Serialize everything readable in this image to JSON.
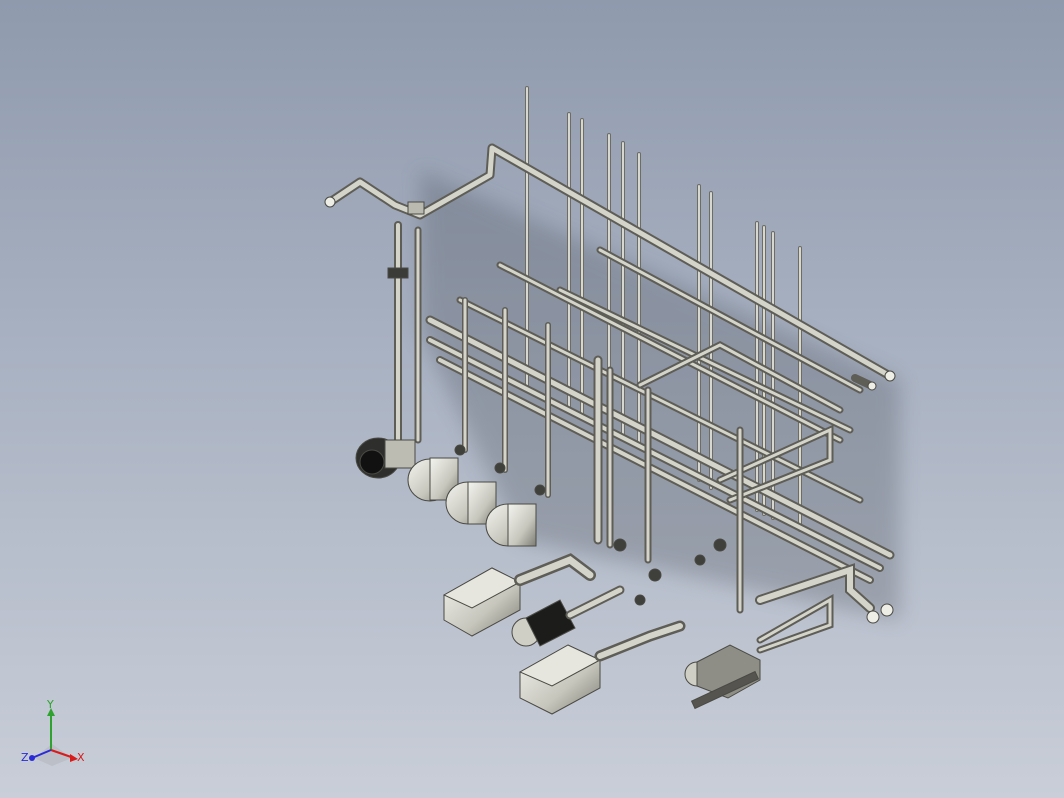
{
  "view": {
    "background_top": "#8f9aad",
    "background_bottom": "#c9ced8",
    "model": "pipe-skid-assembly",
    "pipe_color": "#c8c7bd",
    "pipe_shade": "#77766e",
    "pump_body_color": "#cfcfc6"
  },
  "triad": {
    "x_label": "X",
    "y_label": "Y",
    "z_label": "Z",
    "x_color": "#d81b1b",
    "y_color": "#2fa12f",
    "z_color": "#2a2ad8"
  }
}
